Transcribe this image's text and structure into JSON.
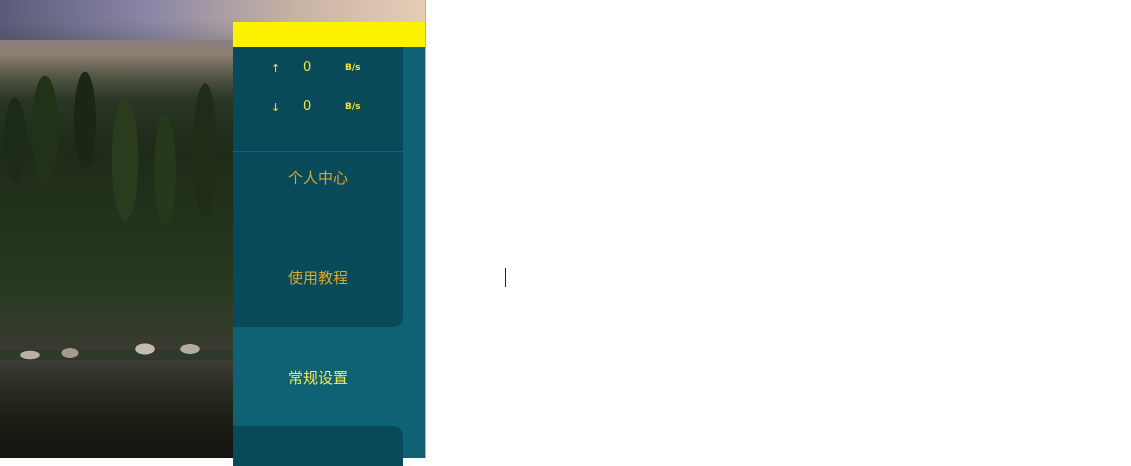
{
  "speed": {
    "upload": {
      "arrow": "↑",
      "value": "0",
      "unit": "B/s"
    },
    "download": {
      "arrow": "↓",
      "value": "0",
      "unit": "B/s"
    }
  },
  "menu": {
    "personal_center": "个人中心",
    "tutorial": "使用教程",
    "general_settings": "常规设置"
  },
  "colors": {
    "accent_yellow": "#fff200",
    "panel": "#0f6273",
    "panel_dark": "#084a59",
    "menu_text": "#d8a82b",
    "menu_active_text": "#f5ea52"
  }
}
